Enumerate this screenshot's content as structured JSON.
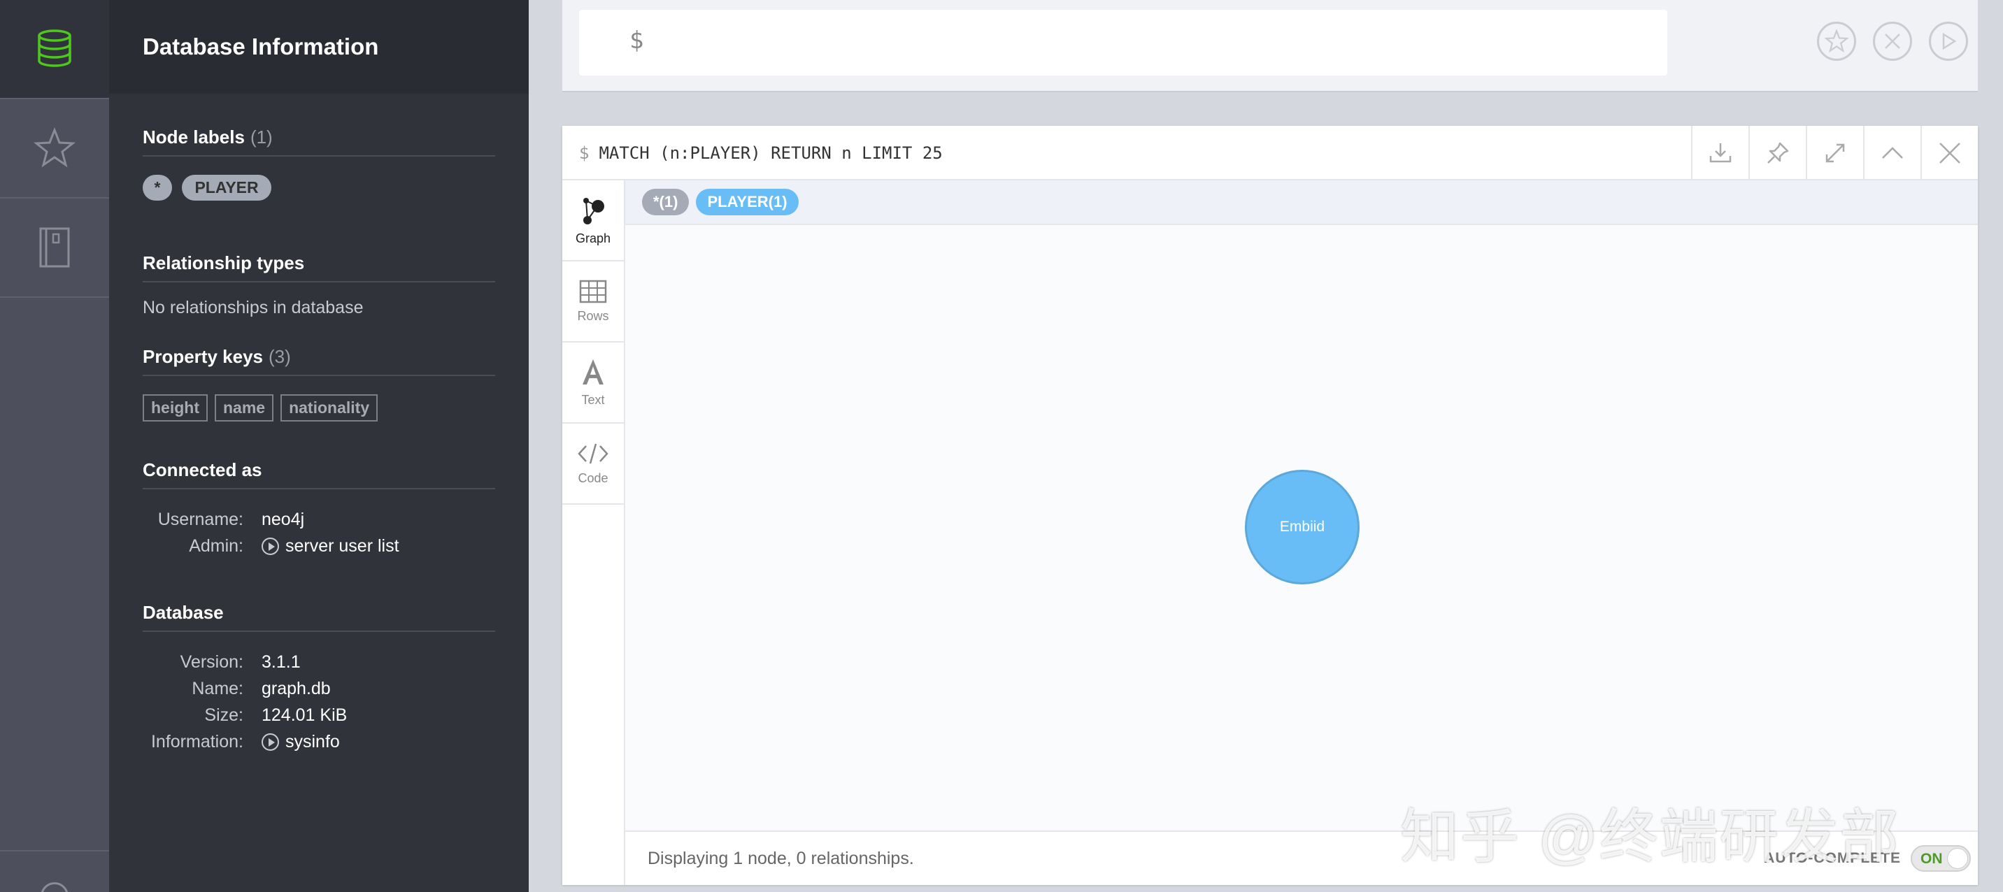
{
  "rail": {
    "items": [
      {
        "icon": "database-icon",
        "active": true
      },
      {
        "icon": "star-icon",
        "active": false
      },
      {
        "icon": "book-icon",
        "active": false
      }
    ]
  },
  "drawer": {
    "title": "Database Information",
    "node_labels": {
      "title": "Node labels",
      "count": "(1)",
      "pills": [
        "*",
        "PLAYER"
      ]
    },
    "relationship_types": {
      "title": "Relationship types",
      "empty": "No relationships in database"
    },
    "property_keys": {
      "title": "Property keys",
      "count": "(3)",
      "keys": [
        "height",
        "name",
        "nationality"
      ]
    },
    "connected_as": {
      "title": "Connected as",
      "username_label": "Username:",
      "username": "neo4j",
      "admin_label": "Admin:",
      "admin_link": "server user list"
    },
    "database": {
      "title": "Database",
      "version_label": "Version:",
      "version": "3.1.1",
      "name_label": "Name:",
      "name": "graph.db",
      "size_label": "Size:",
      "size": "124.01 KiB",
      "info_label": "Information:",
      "info_link": "sysinfo"
    }
  },
  "editor": {
    "prompt": "$"
  },
  "frame": {
    "query_prefix": "$",
    "query": "MATCH (n:PLAYER) RETURN n LIMIT 25",
    "view_tabs": [
      {
        "label": "Graph",
        "icon": "graph-icon",
        "active": true
      },
      {
        "label": "Rows",
        "icon": "table-icon",
        "active": false
      },
      {
        "label": "Text",
        "icon": "text-icon",
        "active": false
      },
      {
        "label": "Code",
        "icon": "code-icon",
        "active": false
      }
    ],
    "legend": {
      "all": "*(1)",
      "player": "PLAYER(1)"
    },
    "node_caption": "Embiid",
    "status": "Displaying 1 node, 0 relationships.",
    "autocomplete_label": "AUTO-COMPLETE",
    "autocomplete_state": "ON"
  },
  "watermark": "知乎 @终端研发部",
  "colors": {
    "accent_green": "#4fc71e",
    "node_blue": "#68bdf6",
    "pill_grey": "#a5abb6"
  }
}
